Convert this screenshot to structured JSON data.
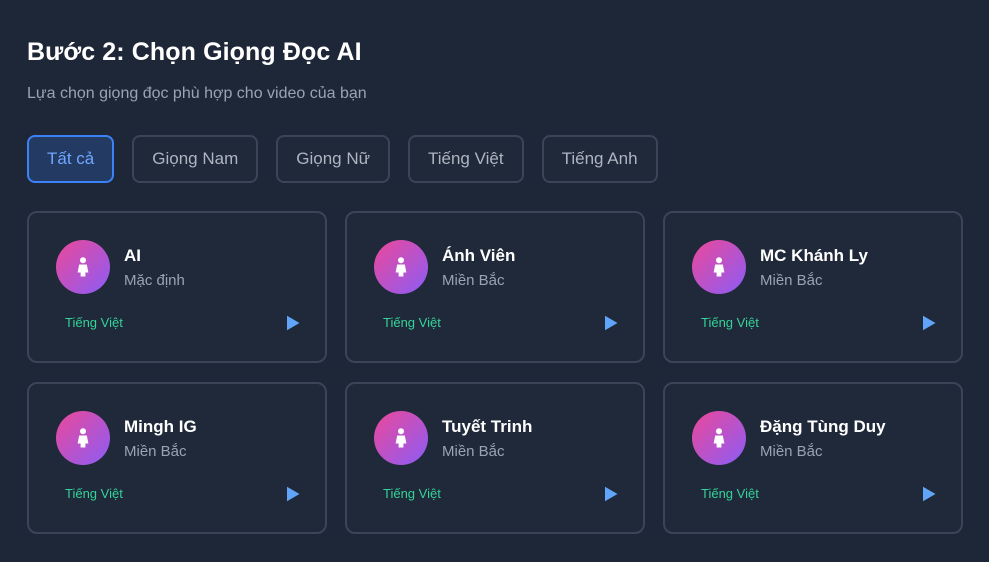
{
  "header": {
    "title": "Bước 2: Chọn Giọng Đọc AI",
    "subtitle": "Lựa chọn giọng đọc phù hợp cho video của bạn"
  },
  "filters": [
    {
      "label": "Tất cả",
      "active": true
    },
    {
      "label": "Giọng Nam",
      "active": false
    },
    {
      "label": "Giọng Nữ",
      "active": false
    },
    {
      "label": "Tiếng Việt",
      "active": false
    },
    {
      "label": "Tiếng Anh",
      "active": false
    }
  ],
  "voices": [
    {
      "name": "AI",
      "region": "Mặc định",
      "language": "Tiếng Việt"
    },
    {
      "name": "Ánh Viên",
      "region": "Miền Bắc",
      "language": "Tiếng Việt"
    },
    {
      "name": "MC Khánh Ly",
      "region": "Miền Bắc",
      "language": "Tiếng Việt"
    },
    {
      "name": "Mingh IG",
      "region": "Miền Bắc",
      "language": "Tiếng Việt"
    },
    {
      "name": "Tuyết Trinh",
      "region": "Miền Bắc",
      "language": "Tiếng Việt"
    },
    {
      "name": "Đặng Tùng Duy",
      "region": "Miền Bắc",
      "language": "Tiếng Việt"
    }
  ],
  "icons": {
    "avatar": "person-icon",
    "play": "play-icon"
  },
  "colors": {
    "background": "#1e2738",
    "card": "#1f2939",
    "border": "#3a4558",
    "accent": "#3b82f6",
    "language": "#34d399",
    "avatar_gradient_start": "#ec4899",
    "avatar_gradient_end": "#8b5cf6"
  }
}
